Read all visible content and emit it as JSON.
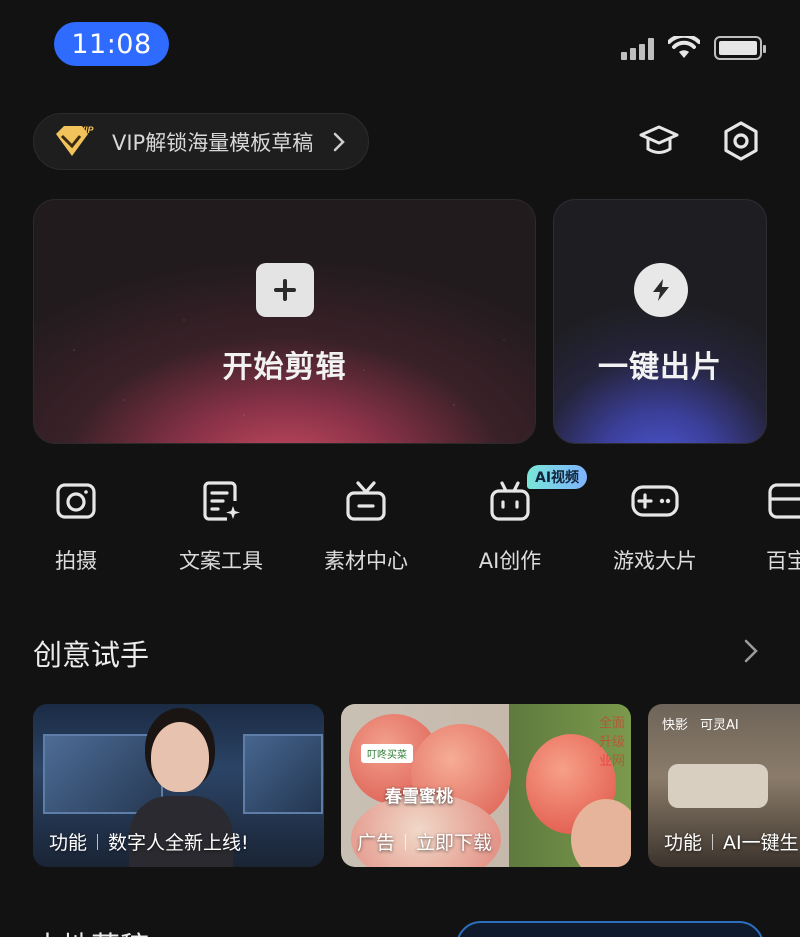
{
  "status_bar": {
    "time": "11:08"
  },
  "vip_banner": {
    "badge": "VIP",
    "text": "VIP解锁海量模板草稿"
  },
  "cards": {
    "start_edit": "开始剪辑",
    "one_click": "一键出片"
  },
  "tools": [
    {
      "label": "拍摄",
      "icon": "camera-icon"
    },
    {
      "label": "文案工具",
      "icon": "script-icon"
    },
    {
      "label": "素材中心",
      "icon": "media-icon"
    },
    {
      "label": "AI创作",
      "icon": "robot-icon",
      "badge": "AI视频"
    },
    {
      "label": "游戏大片",
      "icon": "gamepad-icon"
    },
    {
      "label": "百宝",
      "icon": "toolbox-icon"
    }
  ],
  "section": {
    "title": "创意试手",
    "items": [
      {
        "tag": "功能",
        "caption": "数字人全新上线!"
      },
      {
        "tag": "广告",
        "caption": "立即下载",
        "headline": "春雪蜜桃",
        "shop_tag": "叮咚买菜",
        "watermark": "全面升级业网"
      },
      {
        "tag": "功能",
        "caption": "AI一键生",
        "brand_left": "快影",
        "brand_right": "可灵AI"
      }
    ]
  },
  "bottom_section": {
    "title": "本地草稿"
  },
  "colors": {
    "accent": "#2f6bff",
    "background": "#121212"
  }
}
